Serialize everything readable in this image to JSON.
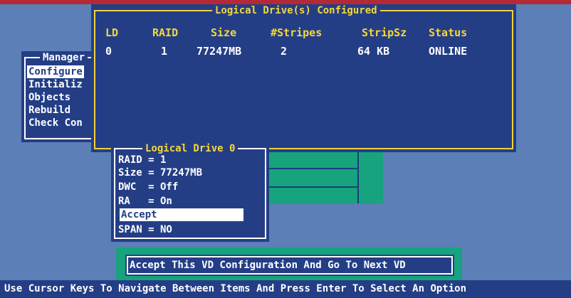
{
  "logical_drives_window": {
    "title": "Logical Drive(s) Configured",
    "columns": [
      "LD",
      "RAID",
      "Size",
      "#Stripes",
      "StripSz",
      "Status"
    ],
    "rows": [
      {
        "ld": "0",
        "raid": "1",
        "size": "77247MB",
        "stripes": "2",
        "stripsz": "64 KB",
        "status": "ONLINE"
      }
    ]
  },
  "management_menu": {
    "title": "Manager",
    "items": [
      "Configure",
      "Initializ",
      "Objects",
      "Rebuild",
      "Check Con"
    ]
  },
  "logical_drive_panel": {
    "title": "Logical Drive 0",
    "items": [
      "RAID = 1",
      "Size = 77247MB",
      "DWC  = Off",
      "RA   = On",
      "Accept",
      "SPAN = NO"
    ]
  },
  "accept_prompt": {
    "label": "Accept This VD Configuration And Go To Next VD"
  },
  "status_bar": {
    "text": "Use Cursor Keys To Navigate Between Items And Press Enter To Select An Option"
  },
  "colors": {
    "screen_background": "#5b7fb6",
    "window_background": "#243e86",
    "border_yellow": "#f2d23c",
    "highlight_white": "#ffffff",
    "teal": "#17a37d"
  }
}
